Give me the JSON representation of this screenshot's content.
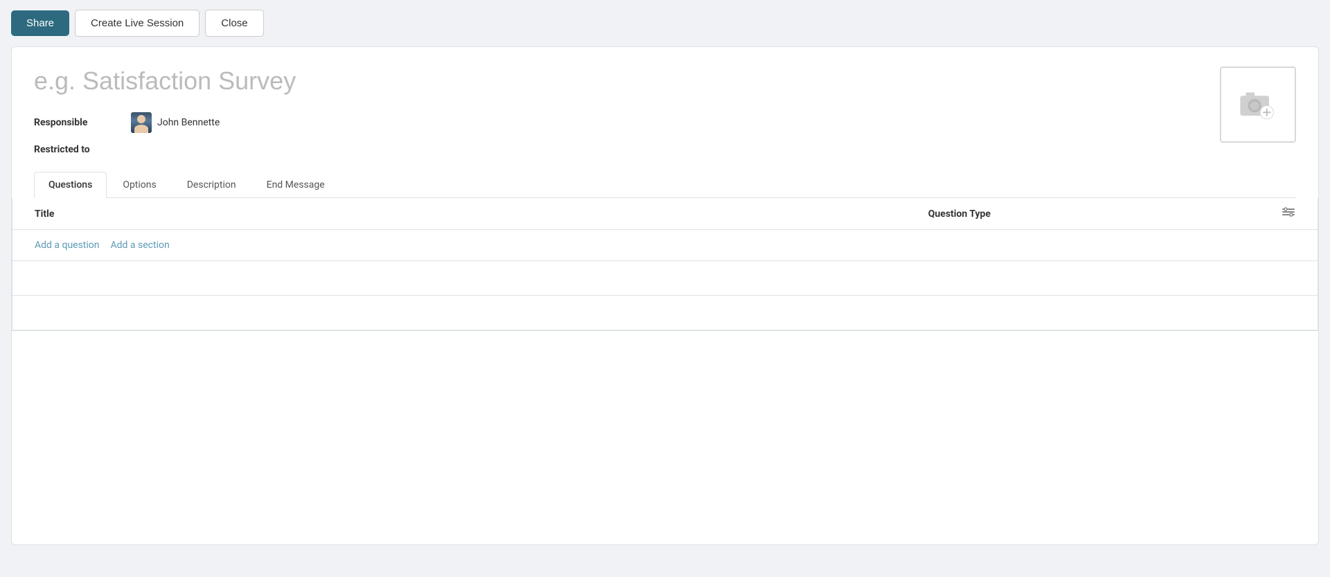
{
  "toolbar": {
    "share_label": "Share",
    "create_live_session_label": "Create Live Session",
    "close_label": "Close"
  },
  "form": {
    "title_placeholder": "e.g. Satisfaction Survey",
    "responsible_label": "Responsible",
    "responsible_person": "John Bennette",
    "restricted_to_label": "Restricted to",
    "camera_icon_title": "Add cover image"
  },
  "tabs": [
    {
      "label": "Questions",
      "active": true
    },
    {
      "label": "Options",
      "active": false
    },
    {
      "label": "Description",
      "active": false
    },
    {
      "label": "End Message",
      "active": false
    }
  ],
  "table": {
    "col_title": "Title",
    "col_question_type": "Question Type",
    "add_question_label": "Add a question",
    "add_section_label": "Add a section"
  },
  "icons": {
    "camera": "📷",
    "settings": "⚙",
    "filter": "≡"
  }
}
